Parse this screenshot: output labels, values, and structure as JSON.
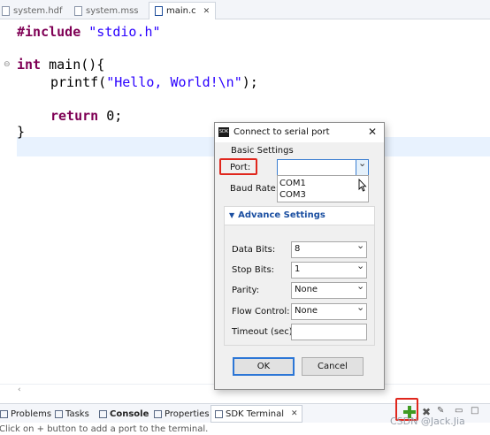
{
  "editor_tabs": [
    {
      "label": "system.hdf",
      "active": false
    },
    {
      "label": "system.mss",
      "active": false
    },
    {
      "label": "main.c",
      "active": true
    }
  ],
  "code": {
    "line1_kw": "#include",
    "line1_str": "\"stdio.h\"",
    "line2_kw": "int",
    "line2_rest": " main(){",
    "line3_fn": "printf(",
    "line3_str": "\"Hello, World!\\n\"",
    "line3_end": ");",
    "line4_kw": "return",
    "line4_rest": " 0;",
    "line5": "}"
  },
  "dialog": {
    "title": "Connect to serial port",
    "icon_text": "SDK",
    "basic_settings": "Basic Settings",
    "port_label": "Port:",
    "port_value": "",
    "baud_label": "Baud Rate:",
    "port_options": [
      "COM1",
      "COM3"
    ],
    "advance_settings": "Advance Settings",
    "fields": [
      {
        "label": "Data Bits:",
        "value": "8"
      },
      {
        "label": "Stop Bits:",
        "value": "1"
      },
      {
        "label": "Parity:",
        "value": "None"
      },
      {
        "label": "Flow Control:",
        "value": "None"
      }
    ],
    "timeout_label": "Timeout (sec):",
    "timeout_value": "",
    "ok_label": "OK",
    "cancel_label": "Cancel"
  },
  "view_tabs": [
    {
      "label": "Problems"
    },
    {
      "label": "Tasks"
    },
    {
      "label": "Console"
    },
    {
      "label": "Properties"
    },
    {
      "label": "SDK Terminal"
    }
  ],
  "status_hint": "Click on + button to add a port to the terminal.",
  "watermark": "CSDN @Jack.Jia",
  "colors": {
    "keyword": "#7f0055",
    "string": "#2a00ff",
    "highlight_line": "#e8f2fe",
    "annotation_red": "#e0271d",
    "advance_header": "#1b4fa1",
    "add_icon": "#3f9a22"
  },
  "icons": {
    "add_port": "plus-icon",
    "remove": "x-icon",
    "minimize": "minimize-icon",
    "maximize": "maximize-icon"
  }
}
